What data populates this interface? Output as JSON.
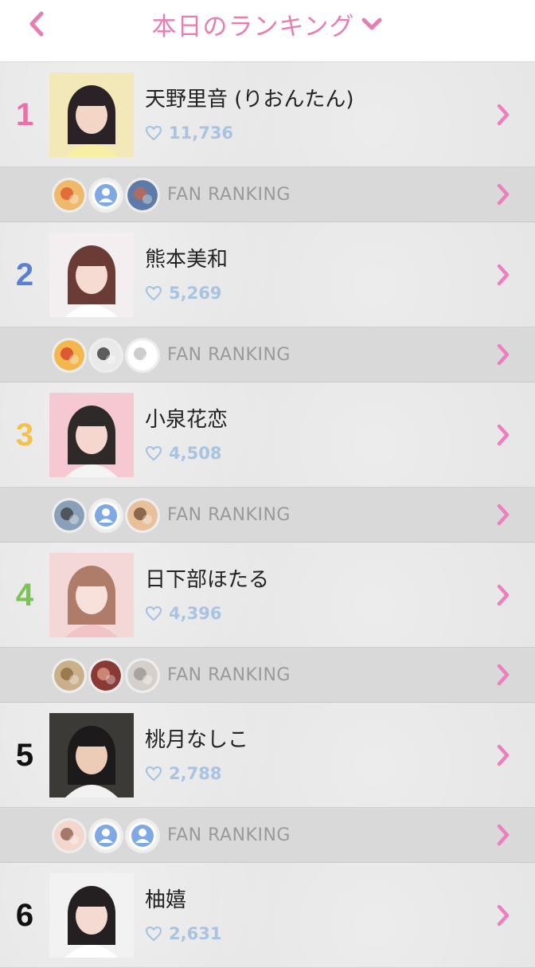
{
  "header": {
    "title": "本日のランキング"
  },
  "fan_ranking_label": "FAN RANKING",
  "ranks": [
    {
      "rank": "1",
      "name": "天野里音 (りおんたん)",
      "likes": "11,736",
      "rank_color": "#f06ea8",
      "photo": {
        "bg": "#f3e9b8",
        "hair": "#2a2226",
        "skin": "#f4d6c6",
        "cloth": "#f7f0a2"
      },
      "fans": [
        {
          "kind": "photo",
          "bg": "#f0b86a",
          "accent": "#d9552b"
        },
        {
          "kind": "default",
          "bg": "#ffffff",
          "accent": "#7fa9e6"
        },
        {
          "kind": "photo",
          "bg": "#5d7aa8",
          "accent": "#c9674b"
        }
      ]
    },
    {
      "rank": "2",
      "name": "熊本美和",
      "likes": "5,269",
      "rank_color": "#5b7fd6",
      "photo": {
        "bg": "#f3eef0",
        "hair": "#6a3c35",
        "skin": "#f6dbd2",
        "cloth": "#ffffff"
      },
      "fans": [
        {
          "kind": "photo",
          "bg": "#f3b74e",
          "accent": "#d43a2a"
        },
        {
          "kind": "photo",
          "bg": "#e9e9e9",
          "accent": "#2c2c2c"
        },
        {
          "kind": "photo",
          "bg": "#ffffff",
          "accent": "#bcbcbc"
        }
      ]
    },
    {
      "rank": "3",
      "name": "小泉花恋",
      "likes": "4,508",
      "rank_color": "#f2c24d",
      "photo": {
        "bg": "#f6c9d2",
        "hair": "#2f2a2a",
        "skin": "#f5d7d0",
        "cloth": "#f4f4f4"
      },
      "fans": [
        {
          "kind": "photo",
          "bg": "#8aa0b8",
          "accent": "#3c3c3c"
        },
        {
          "kind": "default",
          "bg": "#ffffff",
          "accent": "#7fa9e6"
        },
        {
          "kind": "photo",
          "bg": "#e8c09a",
          "accent": "#6b4a33"
        }
      ]
    },
    {
      "rank": "4",
      "name": "日下部ほたる",
      "likes": "4,396",
      "rank_color": "#7ac450",
      "photo": {
        "bg": "#f4d8d8",
        "hair": "#b07c6a",
        "skin": "#f8e1da",
        "cloth": "#f2c4c8"
      },
      "fans": [
        {
          "kind": "photo",
          "bg": "#c9b08a",
          "accent": "#8a6a3a"
        },
        {
          "kind": "photo",
          "bg": "#8a3a34",
          "accent": "#e0a088"
        },
        {
          "kind": "photo",
          "bg": "#d6d0cc",
          "accent": "#9a9490"
        }
      ]
    },
    {
      "rank": "5",
      "name": "桃月なしこ",
      "likes": "2,788",
      "rank_color": "#111111",
      "photo": {
        "bg": "#3c3a36",
        "hair": "#1c1a1a",
        "skin": "#eccbb7",
        "cloth": "#f2f2f2"
      },
      "fans": [
        {
          "kind": "photo",
          "bg": "#f3d6cc",
          "accent": "#8a5a4a"
        },
        {
          "kind": "default",
          "bg": "#ffffff",
          "accent": "#7fa9e6"
        },
        {
          "kind": "default",
          "bg": "#ffffff",
          "accent": "#7fa9e6"
        }
      ]
    },
    {
      "rank": "6",
      "name": "柚嬉",
      "likes": "2,631",
      "rank_color": "#111111",
      "photo": {
        "bg": "#f2f2f2",
        "hair": "#241f20",
        "skin": "#f4dad0",
        "cloth": "#ffffff"
      },
      "fans": []
    }
  ],
  "colors": {
    "accent_pink": "#e57fb3",
    "likes_blue": "#a8c4e0"
  },
  "icons": {
    "back": "chevron-left-icon",
    "title_dropdown": "chevron-down-icon",
    "row_arrow": "chevron-right-icon",
    "likes": "heart-outline-icon",
    "default_avatar": "user-icon"
  }
}
